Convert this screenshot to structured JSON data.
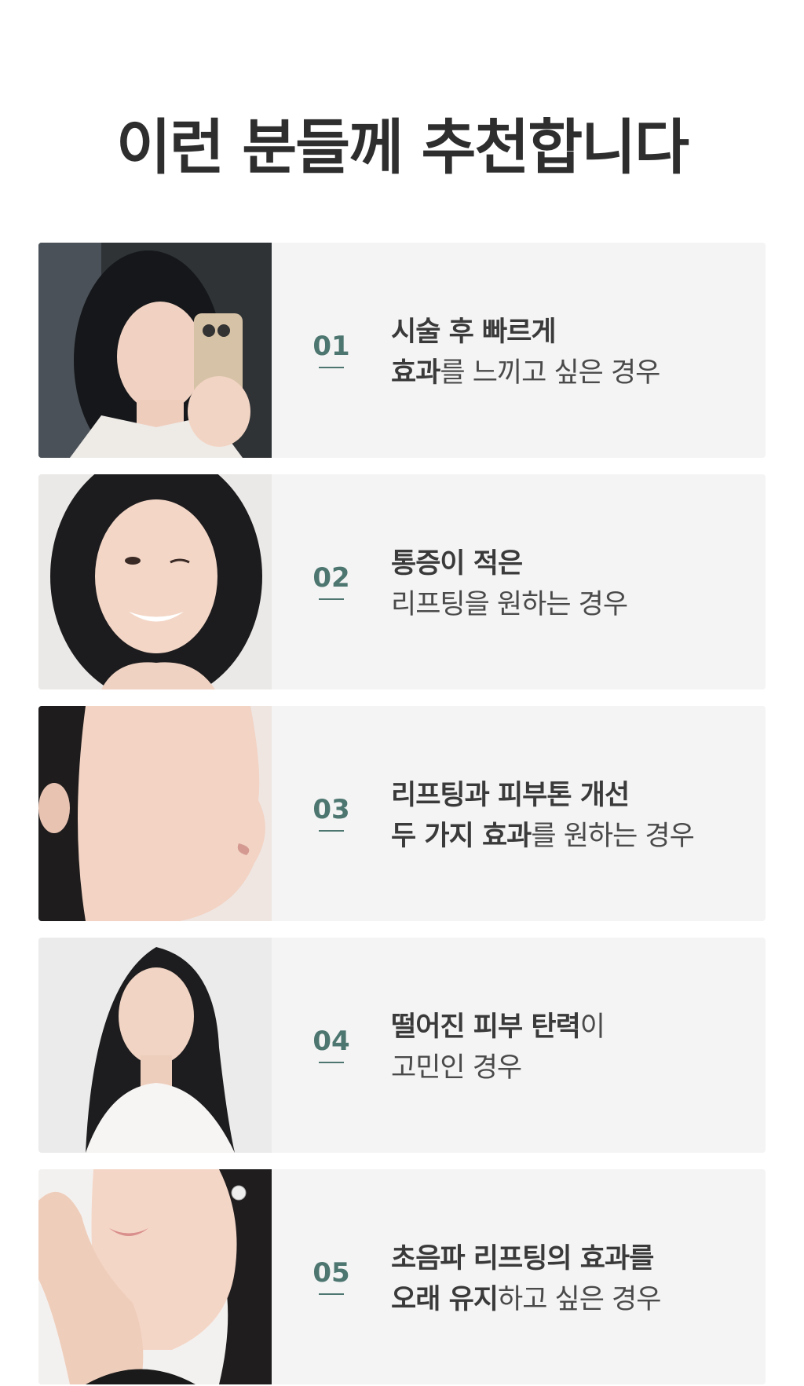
{
  "title": "이런 분들께 추천합니다",
  "colors": {
    "accent": "#4d7670",
    "card_bg": "#f4f4f4",
    "title": "#2e2e2e"
  },
  "items": [
    {
      "number": "01",
      "line1_bold": "시술 후 빠르게",
      "line1_regular": "",
      "line2_bold": "효과",
      "line2_regular": "를 느끼고 싶은 경우"
    },
    {
      "number": "02",
      "line1_bold": "통증이 적은",
      "line1_regular": "",
      "line2_bold": "",
      "line2_regular": "리프팅을 원하는 경우"
    },
    {
      "number": "03",
      "line1_bold": "리프팅과 피부톤 개선",
      "line1_regular": "",
      "line2_bold": "두 가지 효과",
      "line2_regular": "를 원하는 경우"
    },
    {
      "number": "04",
      "line1_bold": "떨어진 피부 탄력",
      "line1_regular": "이",
      "line2_bold": "",
      "line2_regular": "고민인 경우"
    },
    {
      "number": "05",
      "line1_bold": "초음파 리프팅의 효과를",
      "line1_regular": "",
      "line2_bold": "오래 유지",
      "line2_regular": "하고 싶은 경우"
    }
  ]
}
